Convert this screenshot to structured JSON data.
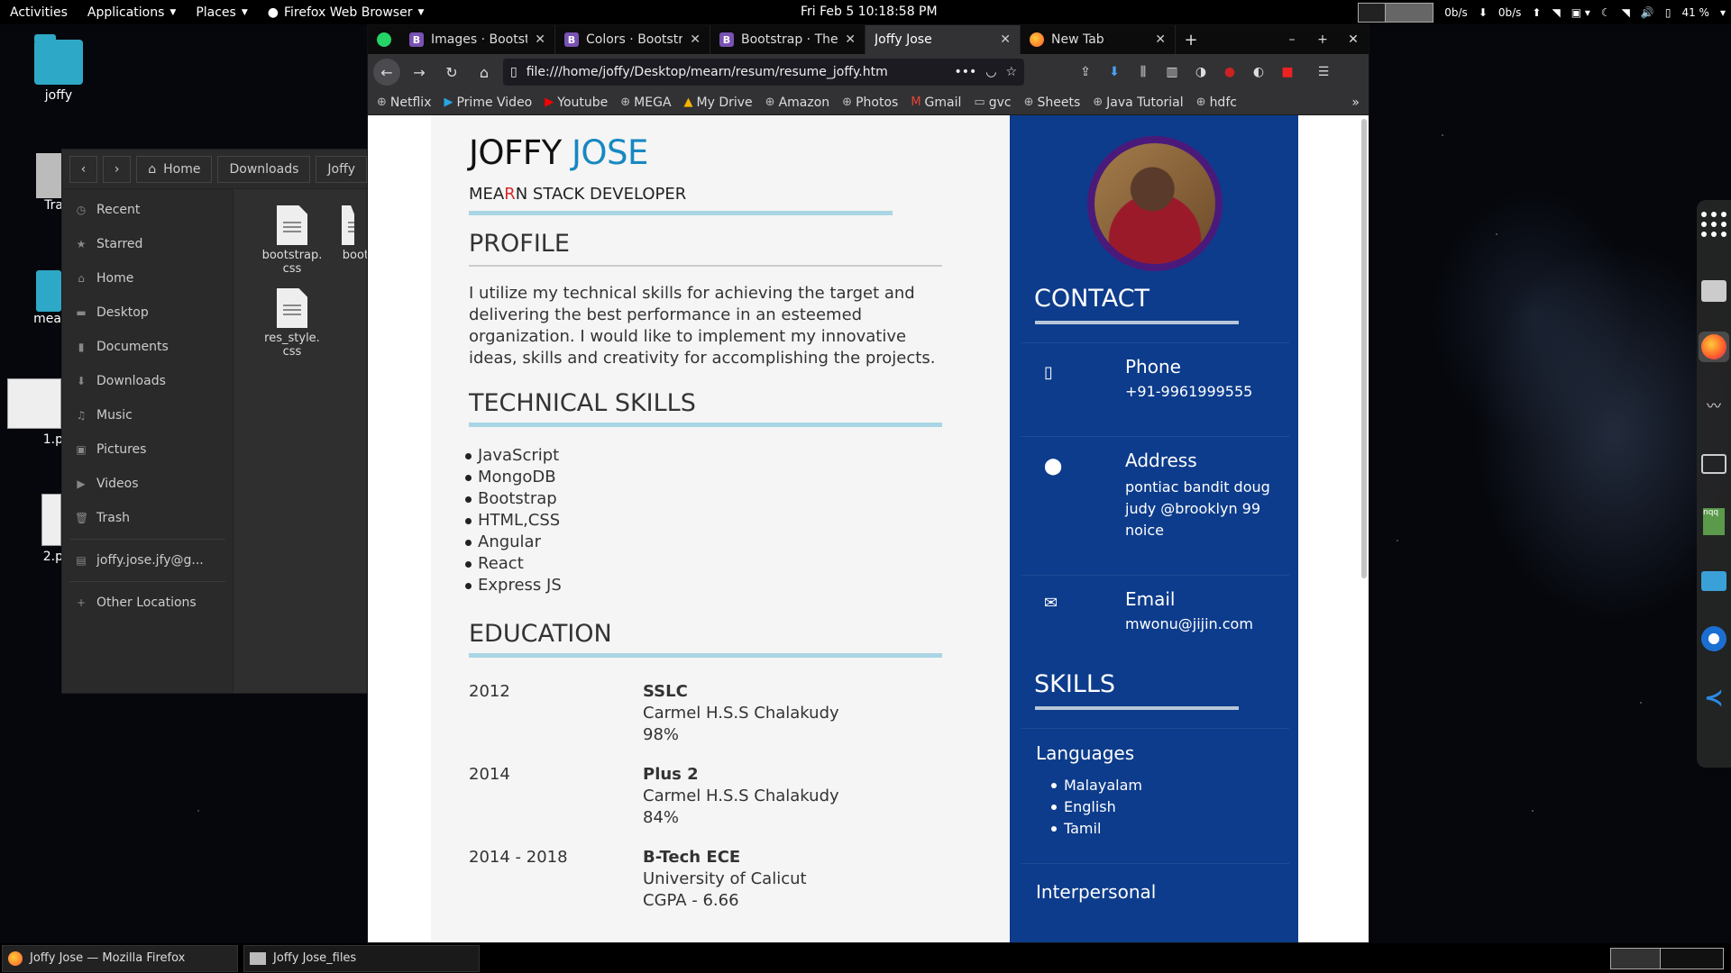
{
  "topbar": {
    "activities": "Activities",
    "applications": "Applications",
    "places": "Places",
    "browser": "Firefox Web Browser",
    "clock": "Fri Feb 5  10:18:58 PM",
    "net_down": "0b/s",
    "net_up": "0b/s",
    "battery": "41 %"
  },
  "desktop": {
    "home_icon_label": "joffy",
    "trash_label": "Tra",
    "folder_label": "mea",
    "thumb1_label": "1.p",
    "thumb2_label": "2.p"
  },
  "files": {
    "breadcrumb": [
      "Home",
      "Downloads",
      "Joffy"
    ],
    "sidebar": [
      {
        "icon": "clock-icon",
        "label": "Recent"
      },
      {
        "icon": "star-icon",
        "label": "Starred"
      },
      {
        "icon": "home-icon",
        "label": "Home"
      },
      {
        "icon": "desktop-icon",
        "label": "Desktop"
      },
      {
        "icon": "documents-icon",
        "label": "Documents"
      },
      {
        "icon": "downloads-icon",
        "label": "Downloads"
      },
      {
        "icon": "music-icon",
        "label": "Music"
      },
      {
        "icon": "pictures-icon",
        "label": "Pictures"
      },
      {
        "icon": "videos-icon",
        "label": "Videos"
      },
      {
        "icon": "trash-icon",
        "label": "Trash"
      },
      {
        "icon": "drive-icon",
        "label": "joffy.jose.jfy@g..."
      },
      {
        "icon": "plus-icon",
        "label": "Other Locations"
      }
    ],
    "file1": "bootstrap.\ncss",
    "file2": "res_style.\ncss",
    "file3": "boot"
  },
  "browser": {
    "tabs": [
      {
        "label": "Images · Bootstr",
        "fav": "B"
      },
      {
        "label": "Colors · Bootstra",
        "fav": "B"
      },
      {
        "label": "Bootstrap · The",
        "fav": "B"
      },
      {
        "label": "Joffy Jose",
        "fav": ""
      },
      {
        "label": "New Tab",
        "fav": "firefox"
      }
    ],
    "url": "file:///home/joffy/Desktop/mearn/resum/resume_joffy.htm",
    "bookmarks": [
      "Netflix",
      "Prime Video",
      "Youtube",
      "MEGA",
      "My Drive",
      "Amazon",
      "Photos",
      "Gmail",
      "gvc",
      "Sheets",
      "Java Tutorial",
      "hdfc"
    ]
  },
  "resume": {
    "first_name": "JOFFY",
    "last_name": "JOSE",
    "role_pre": "MEA",
    "role_r": "R",
    "role_post": "N STACK DEVELOPER",
    "profile_title": "PROFILE",
    "profile_text": "I utilize my technical skills for achieving the target and delivering the best performance in an esteemed organization. I would like to implement my innovative ideas, skills and creativity for accomplishing the projects.",
    "tech_title": "TECHNICAL SKILLS",
    "tech_skills": [
      "JavaScript",
      "MongoDB",
      "Bootstrap",
      "HTML,CSS",
      "Angular",
      "React",
      "Express JS"
    ],
    "edu_title": "EDUCATION",
    "education": [
      {
        "year": "2012",
        "degree": "SSLC",
        "school": "Carmel H.S.S Chalakudy",
        "score": "98%"
      },
      {
        "year": "2014",
        "degree": "Plus 2",
        "school": "Carmel H.S.S Chalakudy",
        "score": "84%"
      },
      {
        "year": "2014 - 2018",
        "degree": "B-Tech ECE",
        "school": "University of Calicut",
        "score": "CGPA - 6.66"
      }
    ],
    "contact_title": "CONTACT",
    "phone_label": "Phone",
    "phone_value": "+91-9961999555",
    "address_label": "Address",
    "address_value": "pontiac bandit doug judy @brooklyn 99 noice",
    "email_label": "Email",
    "email_value": "mwonu@jijin.com",
    "skills_title": "SKILLS",
    "languages_title": "Languages",
    "languages": [
      "Malayalam",
      "English",
      "Tamil"
    ],
    "interpersonal_title": "Interpersonal"
  },
  "taskbar": {
    "task1": "Joffy Jose — Mozilla Firefox",
    "task2": "Joffy Jose_files"
  }
}
